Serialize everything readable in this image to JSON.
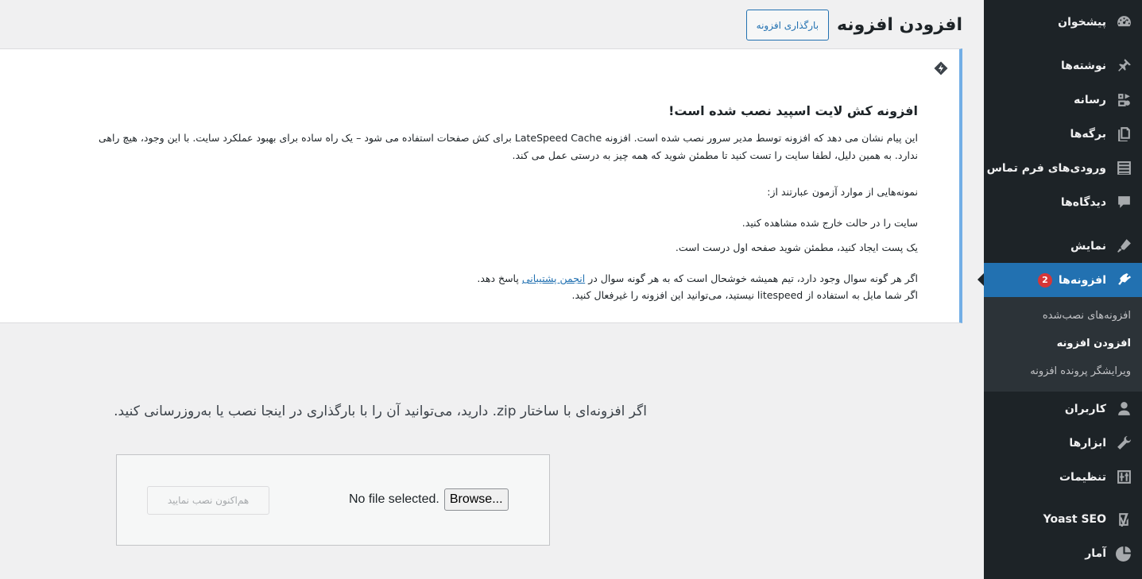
{
  "header": {
    "title": "افزودن افزونه",
    "upload_button": "بارگذاری افزونه"
  },
  "notice": {
    "title": "افزونه کش لایت اسپید نصب شده است!",
    "line1": "این پیام نشان می دهد که افزونه توسط مدیر سرور نصب شده است. افزونه LateSpeed Cache برای کش صفحات استفاده می شود – یک راه ساده برای بهبود عملکرد سایت. با این وجود، هیچ راهی",
    "line2": "ندارد. به همین دلیل، لطفا سایت را تست کنید تا مطمئن شوید که همه چیز به درستی عمل می کند.",
    "examples_heading": "نمونه‌هایی از موارد آزمون عبارتند از:",
    "example1": "سایت را در حالت خارج شده مشاهده کنید.",
    "example2": "یک پست ایجاد کنید، مطمئن شوید صفحه اول درست است.",
    "support_before": "اگر هر گونه سوال وجود دارد، تیم همیشه خوشحال است که به هر گونه سوال در ",
    "support_link": "انجمن پشتیبانی",
    "support_after": " پاسخ دهد.",
    "disable_text": "اگر شما مایل به استفاده از litespeed نیستید، می‌توانید این افزونه را غیرفعال کنید."
  },
  "upload": {
    "description": "اگر افزونه‌ای با ساختار zip. دارید، می‌توانید آن را با بارگذاری در اینجا نصب یا به‌روزرسانی کنید.",
    "browse_label": "Browse...",
    "file_status": "No file selected.",
    "install_button": "هم‌اکنون نصب نمایید"
  },
  "sidebar": {
    "items": [
      {
        "label": "پیشخوان",
        "icon": "dashboard-icon"
      },
      {
        "label": "نوشته‌ها",
        "icon": "pin-icon"
      },
      {
        "label": "رسانه",
        "icon": "media-icon"
      },
      {
        "label": "برگه‌ها",
        "icon": "pages-icon"
      },
      {
        "label": "ورودی‌های فرم تماس",
        "icon": "forms-icon"
      },
      {
        "label": "دیدگاه‌ها",
        "icon": "comments-icon"
      },
      {
        "label": "نمایش",
        "icon": "appearance-icon"
      },
      {
        "label": "افزونه‌ها",
        "icon": "plugins-icon",
        "badge": "2"
      },
      {
        "label": "کاربران",
        "icon": "users-icon"
      },
      {
        "label": "ابزارها",
        "icon": "tools-icon"
      },
      {
        "label": "تنظیمات",
        "icon": "settings-icon"
      },
      {
        "label": "Yoast SEO",
        "icon": "yoast-icon"
      },
      {
        "label": "آمار",
        "icon": "stats-icon"
      }
    ],
    "submenu": [
      {
        "label": "افزونه‌های نصب‌شده"
      },
      {
        "label": "افزودن افزونه"
      },
      {
        "label": "ویرایشگر پرونده افزونه"
      }
    ]
  },
  "colors": {
    "sidebar_bg": "#1d2327",
    "active_bg": "#2271b1",
    "notice_border": "#72aee6",
    "badge_bg": "#d63638"
  }
}
